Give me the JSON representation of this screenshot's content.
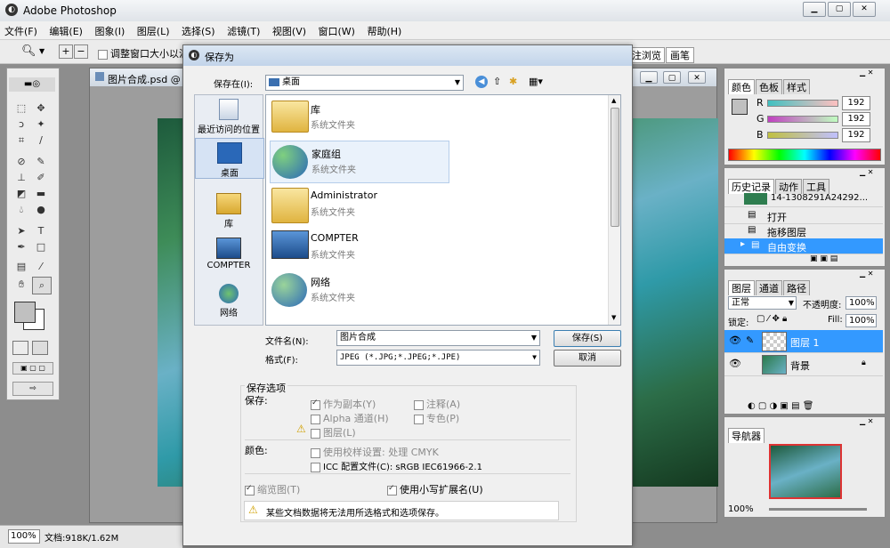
{
  "app": {
    "title": "Adobe Photoshop"
  },
  "menu": [
    "文件(F)",
    "编辑(E)",
    "图象(I)",
    "图层(L)",
    "选择(S)",
    "滤镜(T)",
    "视图(V)",
    "窗口(W)",
    "帮助(H)"
  ],
  "options_bar": {
    "checkbox_label": "调整窗口大小以满",
    "right_tabs": [
      "注浏览",
      "画笔"
    ]
  },
  "document": {
    "title": "图片合成.psd @"
  },
  "status": {
    "zoom": "100%",
    "doc_size": "文档:918K/1.62M"
  },
  "color_panel": {
    "tabs": [
      "颜色",
      "色板",
      "样式"
    ],
    "channels": [
      {
        "label": "R",
        "value": "192"
      },
      {
        "label": "G",
        "value": "192"
      },
      {
        "label": "B",
        "value": "192"
      }
    ]
  },
  "history_panel": {
    "tabs": [
      "历史记录",
      "动作",
      "工具"
    ],
    "snapshot": "14-1308291A24292...",
    "items": [
      "打开",
      "拖移图层",
      "自由变换"
    ]
  },
  "layers_panel": {
    "tabs": [
      "图层",
      "通道",
      "路径"
    ],
    "blend_mode": "正常",
    "opacity_label": "不透明度:",
    "opacity": "100%",
    "lock_label": "锁定:",
    "fill_label": "Fill:",
    "fill": "100%",
    "layers": [
      "图层 1",
      "背景"
    ]
  },
  "navigator_panel": {
    "tab": "导航器",
    "zoom": "100%"
  },
  "dialog": {
    "title": "保存为",
    "save_in_label": "保存在(I):",
    "save_in_value": "桌面",
    "places": [
      "最近访问的位置",
      "桌面",
      "库",
      "COMPTER",
      "网络"
    ],
    "files": [
      {
        "name": "库",
        "type": "系统文件夹"
      },
      {
        "name": "家庭组",
        "type": "系统文件夹"
      },
      {
        "name": "Administrator",
        "type": "系统文件夹"
      },
      {
        "name": "COMPTER",
        "type": "系统文件夹"
      },
      {
        "name": "网络",
        "type": "系统文件夹"
      }
    ],
    "filename_label": "文件名(N):",
    "filename_value": "图片合成",
    "format_label": "格式(F):",
    "format_value": "JPEG (*.JPG;*.JPEG;*.JPE)",
    "save_button": "保存(S)",
    "cancel_button": "取消",
    "save_options_title": "保存选项",
    "save_label": "保存:",
    "as_copy": "作为副本(Y)",
    "alpha_channels": "Alpha 通道(H)",
    "layers_opt": "图层(L)",
    "annotations": "注释(A)",
    "spot_colors": "专色(P)",
    "color_label": "颜色:",
    "use_proof": "使用校样设置: 处理 CMYK",
    "icc_profile": "ICC 配置文件(C): sRGB IEC61966-2.1",
    "thumbnail": "缩览图(T)",
    "lowercase_ext": "使用小写扩展名(U)",
    "warning_text": "某些文档数据将无法用所选格式和选项保存。"
  },
  "colors": {
    "accent": "#3399ff",
    "titlebar": "#dfe3e8"
  }
}
